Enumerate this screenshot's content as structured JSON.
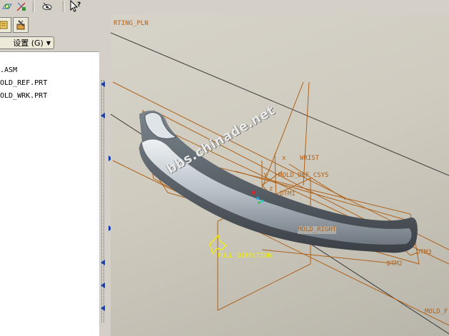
{
  "toolbar": {
    "buttons": [
      {
        "icon": "datum-plane-toggle-icon"
      },
      {
        "icon": "datum-axis-toggle-icon"
      },
      {
        "icon": "hide-view-icon"
      },
      {
        "icon": "context-help-icon"
      }
    ]
  },
  "panel": {
    "tabs": [
      {
        "icon": "model-tree-tab-icon"
      },
      {
        "icon": "tools-tab-icon"
      }
    ],
    "settings_label": "设置 (G)",
    "settings_arrow": "▼",
    "tree_items": [
      ".ASM",
      "OLD_REF.PRT",
      "OLD_WRK.PRT"
    ]
  },
  "graphics": {
    "labels": {
      "parting_plane": "RTING_PLN",
      "wrist": "WRIST",
      "def_csys": "MOLD_DEF_CSYS",
      "dtm1": "DTM1",
      "mold_right": "MOLD_RIGHT",
      "pull_direction": "PULL DIRECTION",
      "dtm2": "DTM2",
      "dtm3": "DTM3",
      "mold_front": "MOLD_F",
      "axis_x": "x",
      "axis_y": "y",
      "axis_z": "z"
    },
    "watermark": "bbs.chinade.net",
    "colors": {
      "datum": "#b0621a",
      "pull_direction": "#f3f000",
      "background": "#cfcbbf",
      "part": "#a9b2b9"
    }
  }
}
